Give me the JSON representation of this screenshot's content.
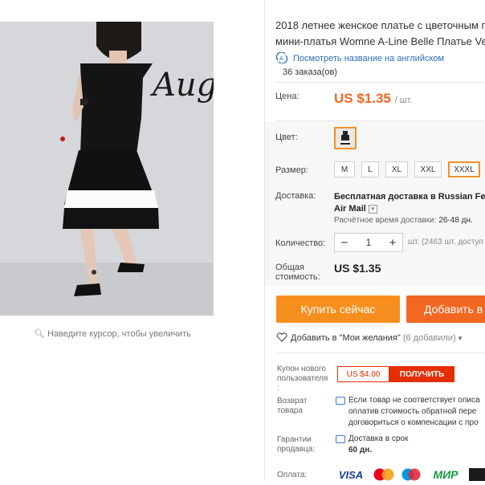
{
  "gallery": {
    "photo_text": "Aug",
    "zoom_hint": "Наведите курсор, чтобы увеличить"
  },
  "product": {
    "title_line1": "2018 летнее женское платье с цветочным п",
    "title_line2": "мини-платья Womne A-Line Belle Платье Ve",
    "translate_link": "Посмотреть название на английском",
    "orders": "36 заказа(ов)"
  },
  "pricing": {
    "price_label": "Цена:",
    "price": "US $1.35",
    "unit": "/ шт."
  },
  "options": {
    "color_label": "Цвет:",
    "size_label": "Размер:",
    "sizes": [
      "M",
      "L",
      "XL",
      "XXL",
      "XXXL"
    ],
    "selected_size": "XXXL"
  },
  "shipping": {
    "label": "Доставка:",
    "method_line1": "Бесплатная доставка в Russian Fede",
    "method_line2": "Air Mail",
    "estimate_label": "Расчётное время доставки:",
    "estimate_value": "26-48 дн."
  },
  "quantity": {
    "label": "Количество:",
    "minus": "−",
    "value": "1",
    "plus": "+",
    "stock": "шт. (2463 шт. доступ"
  },
  "total": {
    "label_line1": "Общая",
    "label_line2": "стоимость:",
    "value": "US $1.35"
  },
  "actions": {
    "buy_now": "Купить сейчас",
    "add_to_cart": "Добавить в",
    "wishlist": "Добавить в \"Мои желания\"",
    "wishlist_count": "(6 добавили)"
  },
  "coupon": {
    "label_line1": "Купон нового",
    "label_line2": "пользователя",
    "label_line3": ":",
    "value": "US $4.00",
    "button": "ПОЛУЧИТЬ"
  },
  "guarantees": {
    "returns_label_line1": "Возврат",
    "returns_label_line2": "товара",
    "returns_text_line1": "Если товар не соответствует описа",
    "returns_text_line2": "оплатив стоимость обратной пере",
    "returns_text_line3": "договориться о компенсации с про",
    "seller_label_line1": "Гарантии",
    "seller_label_line2": "продавца:",
    "seller_text_line1": "Доставка в срок",
    "seller_text_line2": "60 дн."
  },
  "payment": {
    "label": "Оплата:",
    "methods": [
      "VISA",
      "MasterCard",
      "Maestro",
      "МИР"
    ]
  },
  "colors": {
    "accent_orange": "#f26722",
    "buy_orange": "#f78f1e",
    "coupon_red": "#e62e04",
    "link_blue": "#2a6ebb"
  }
}
